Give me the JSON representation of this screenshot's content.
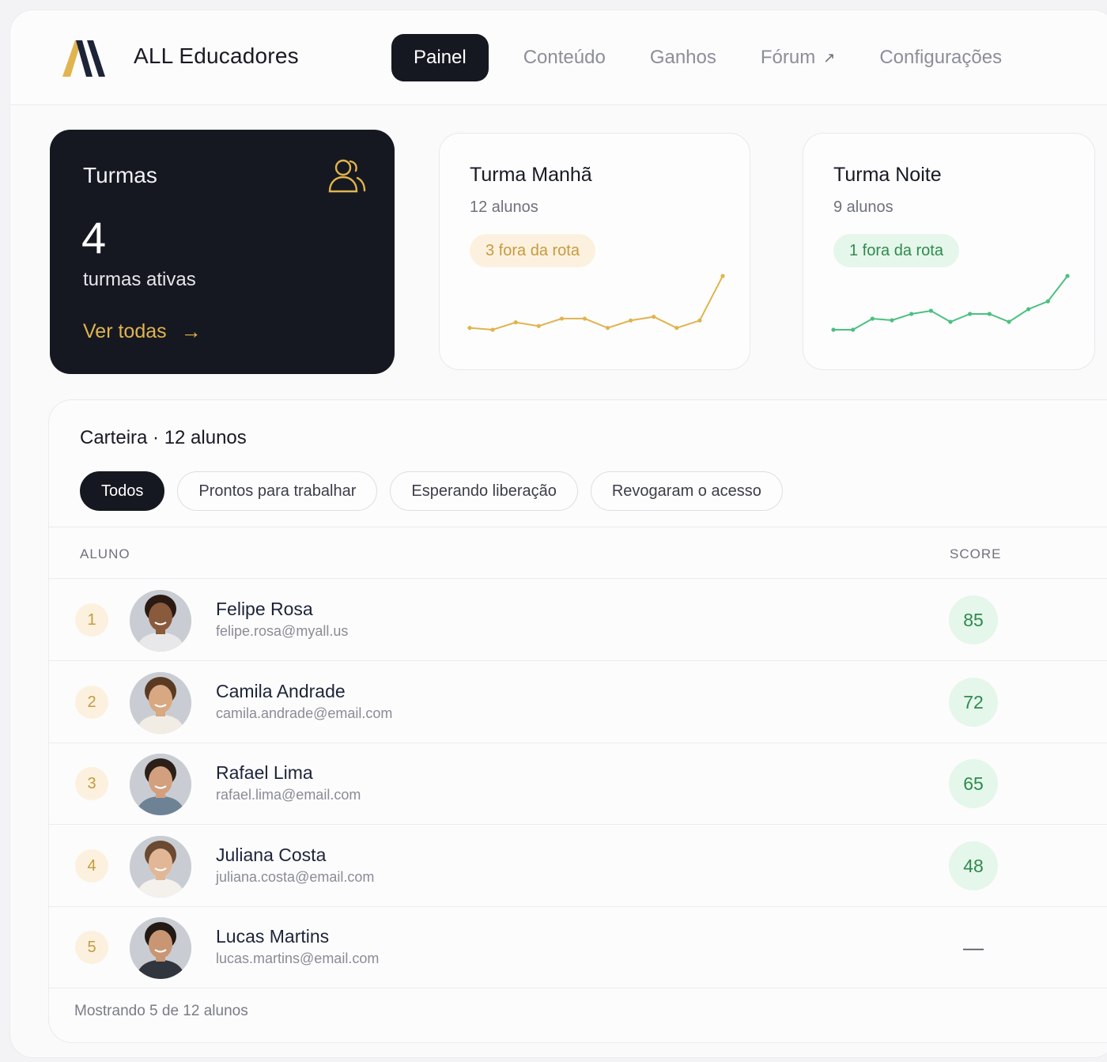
{
  "app": {
    "brand": "ALL Educadores",
    "nav": [
      {
        "label": "Painel",
        "active": true
      },
      {
        "label": "Conteúdo"
      },
      {
        "label": "Ganhos"
      },
      {
        "label": "Fórum",
        "external": true
      },
      {
        "label": "Configurações"
      }
    ]
  },
  "stats": {
    "turmas": {
      "title": "Turmas",
      "count": "4",
      "subtitle": "turmas ativas",
      "link_label": "Ver todas",
      "icon": "users-icon"
    },
    "classes": [
      {
        "title": "Turma Manhã",
        "students": "12 alunos",
        "badge": "3 fora da rota",
        "badge_color": "#c79a3f",
        "badge_bg": "#fbf1de",
        "line_color": "#e0b44e",
        "trend": [
          3,
          2,
          6,
          4,
          8,
          8,
          3,
          7,
          9,
          3,
          7,
          31
        ]
      },
      {
        "title": "Turma Noite",
        "students": "9 alunos",
        "badge": "1 fora da rota",
        "badge_color": "#2f8a4f",
        "badge_bg": "#e5f6ea",
        "line_color": "#4cc081",
        "trend": [
          2,
          2,
          9,
          8,
          12,
          14,
          7,
          12,
          12,
          7,
          15,
          20,
          36
        ]
      }
    ]
  },
  "wallet": {
    "heading": "Carteira · 12 alunos",
    "filters": [
      {
        "label": "Todos",
        "active": true
      },
      {
        "label": "Prontos para trabalhar"
      },
      {
        "label": "Esperando liberação"
      },
      {
        "label": "Revogaram o acesso"
      }
    ],
    "columns": {
      "student": "ALUNO",
      "score": "SCORE"
    },
    "rows": [
      {
        "rank": "1",
        "name": "Felipe Rosa",
        "email": "felipe.rosa@myall.us",
        "score": "85",
        "skin": "#8a5a3c",
        "hair": "#2a1a12",
        "shirt": "#e8e8ea"
      },
      {
        "rank": "2",
        "name": "Camila Andrade",
        "email": "camila.andrade@email.com",
        "score": "72",
        "skin": "#d8a882",
        "hair": "#5a3a22",
        "shirt": "#f2ede4"
      },
      {
        "rank": "3",
        "name": "Rafael Lima",
        "email": "rafael.lima@email.com",
        "score": "65",
        "skin": "#d2a07e",
        "hair": "#2a2018",
        "shirt": "#6e8296"
      },
      {
        "rank": "4",
        "name": "Juliana Costa",
        "email": "juliana.costa@email.com",
        "score": "48",
        "skin": "#e2b796",
        "hair": "#6a4a30",
        "shirt": "#f4f1ec"
      },
      {
        "rank": "5",
        "name": "Lucas Martins",
        "email": "lucas.martins@email.com",
        "score": "—",
        "skin": "#c99674",
        "hair": "#231a14",
        "shirt": "#30353e"
      }
    ],
    "footer": "Mostrando 5 de 12 alunos"
  }
}
